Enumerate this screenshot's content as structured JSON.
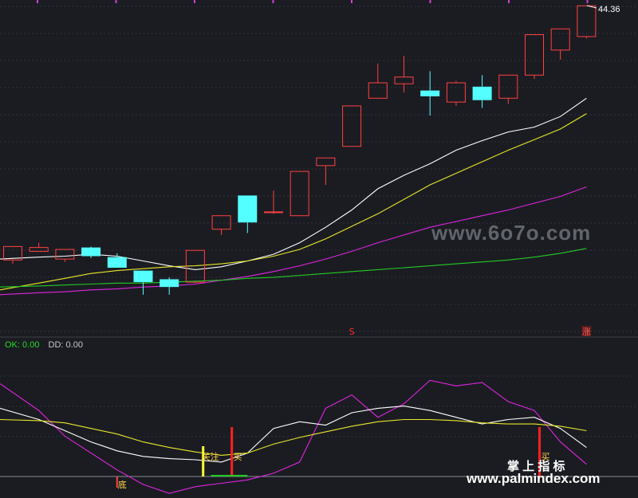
{
  "chart_data": [
    {
      "type": "candlestick",
      "price_ylim": [
        27.4,
        44.9
      ],
      "last_price": "44.36",
      "candles": [
        {
          "o": 31.4,
          "c": 32.1,
          "h": 32.1,
          "l": 31.2
        },
        {
          "o": 31.85,
          "c": 32.05,
          "h": 32.3,
          "l": 31.85
        },
        {
          "o": 31.45,
          "c": 31.95,
          "h": 31.95,
          "l": 31.3
        },
        {
          "o": 32.05,
          "c": 31.6,
          "h": 32.1,
          "l": 31.5
        },
        {
          "o": 31.55,
          "c": 31.0,
          "h": 31.75,
          "l": 31.0
        },
        {
          "o": 30.85,
          "c": 30.25,
          "h": 30.85,
          "l": 29.6
        },
        {
          "o": 30.4,
          "c": 30.0,
          "h": 30.5,
          "l": 29.6
        },
        {
          "o": 30.25,
          "c": 31.9,
          "h": 31.9,
          "l": 30.2
        },
        {
          "o": 33.0,
          "c": 33.7,
          "h": 33.7,
          "l": 32.7
        },
        {
          "o": 34.75,
          "c": 33.35,
          "h": 34.75,
          "l": 32.8
        },
        {
          "o": 33.9,
          "c": 33.9,
          "h": 35.0,
          "l": 33.8
        },
        {
          "o": 33.7,
          "c": 36.0,
          "h": 36.0,
          "l": 33.7
        },
        {
          "o": 36.3,
          "c": 36.7,
          "h": 36.7,
          "l": 35.3
        },
        {
          "o": 37.3,
          "c": 39.4,
          "h": 39.4,
          "l": 37.3
        },
        {
          "o": 39.8,
          "c": 40.6,
          "h": 41.6,
          "l": 39.8
        },
        {
          "o": 40.55,
          "c": 40.9,
          "h": 42.0,
          "l": 40.1
        },
        {
          "o": 40.2,
          "c": 39.9,
          "h": 41.2,
          "l": 38.9
        },
        {
          "o": 39.6,
          "c": 40.6,
          "h": 40.7,
          "l": 39.4
        },
        {
          "o": 40.4,
          "c": 39.7,
          "h": 41.0,
          "l": 39.3
        },
        {
          "o": 39.8,
          "c": 41.0,
          "h": 41.0,
          "l": 39.5
        },
        {
          "o": 41.0,
          "c": 43.1,
          "h": 43.1,
          "l": 40.8
        },
        {
          "o": 42.3,
          "c": 43.4,
          "h": 43.4,
          "l": 41.8
        },
        {
          "o": 43.0,
          "c": 44.6,
          "h": 44.6,
          "l": 42.9
        }
      ],
      "moving_averages": [
        {
          "color": "#ffffff",
          "values": [
            31.45,
            31.55,
            31.6,
            31.7,
            31.6,
            31.35,
            31.1,
            30.9,
            31.05,
            31.35,
            31.7,
            32.3,
            33.1,
            34.0,
            35.1,
            35.8,
            36.4,
            37.1,
            37.6,
            38.05,
            38.3,
            38.85,
            39.8
          ]
        },
        {
          "color": "#e8e82a",
          "values": [
            29.85,
            30.2,
            30.45,
            30.7,
            30.85,
            30.95,
            31.05,
            31.1,
            31.2,
            31.35,
            31.6,
            31.95,
            32.5,
            33.15,
            33.8,
            34.55,
            35.3,
            35.9,
            36.5,
            37.1,
            37.65,
            38.2,
            39.0
          ]
        },
        {
          "color": "#e024e0",
          "values": [
            29.6,
            29.7,
            29.75,
            29.85,
            29.9,
            30.0,
            30.05,
            30.15,
            30.35,
            30.55,
            30.8,
            31.1,
            31.45,
            31.85,
            32.3,
            32.7,
            33.1,
            33.4,
            33.7,
            34.0,
            34.35,
            34.7,
            35.2
          ]
        },
        {
          "color": "#22cc22",
          "values": [
            30.0,
            30.05,
            30.1,
            30.15,
            30.2,
            30.2,
            30.25,
            30.3,
            30.35,
            30.45,
            30.5,
            30.6,
            30.7,
            30.8,
            30.9,
            31.0,
            31.1,
            31.2,
            31.3,
            31.4,
            31.55,
            31.75,
            32.0
          ]
        }
      ],
      "signals": [
        {
          "index": 13,
          "text": "S",
          "color": "#ff3030"
        },
        {
          "index": 22,
          "text": "涨",
          "color": "#ff6060"
        }
      ]
    },
    {
      "type": "line",
      "title": "",
      "legend": [
        {
          "name": "OK",
          "value": "0.00",
          "color": "#22dd22"
        },
        {
          "name": "DD",
          "value": "0.00",
          "color": "#c8c8c8"
        }
      ],
      "ylim": [
        -8,
        118
      ],
      "series": [
        {
          "color": "#e024e0",
          "values": [
            92,
            68,
            45,
            30,
            15,
            2,
            -6,
            0,
            3,
            6,
            12,
            22,
            70,
            82,
            62,
            74,
            95,
            90,
            93,
            76,
            68,
            40,
            20
          ]
        },
        {
          "color": "#ffffff",
          "values": [
            70,
            60,
            50,
            40,
            32,
            27,
            25,
            24,
            22,
            30,
            52,
            58,
            55,
            66,
            70,
            72,
            68,
            62,
            56,
            60,
            62,
            52,
            35
          ]
        },
        {
          "color": "#e8e82a",
          "values": [
            60,
            59,
            57,
            52,
            47,
            40,
            35,
            31,
            28,
            30,
            38,
            44,
            49,
            54,
            58,
            60,
            60,
            59,
            57,
            56,
            56,
            54,
            50
          ]
        }
      ],
      "bottom_line_value": 0,
      "marks": [
        {
          "index": 4,
          "text": "底",
          "color": "#ff4444",
          "text_color": "#ffd24a"
        },
        {
          "index": 7.3,
          "text": "关注",
          "color": "#ffff33",
          "text_color": "#ffd24a"
        },
        {
          "index": 8.4,
          "text": "买",
          "color": "#ff2020",
          "text_color": "#ffd24a"
        },
        {
          "index": 20.2,
          "text": "买",
          "color": "#ff2020",
          "text_color": "#ffd24a"
        }
      ]
    }
  ],
  "watermarks": {
    "site_6070": "www.6o7o.com",
    "brand_cn": "掌 上 指 标",
    "site_palmindex": "www.palmindex.com"
  }
}
